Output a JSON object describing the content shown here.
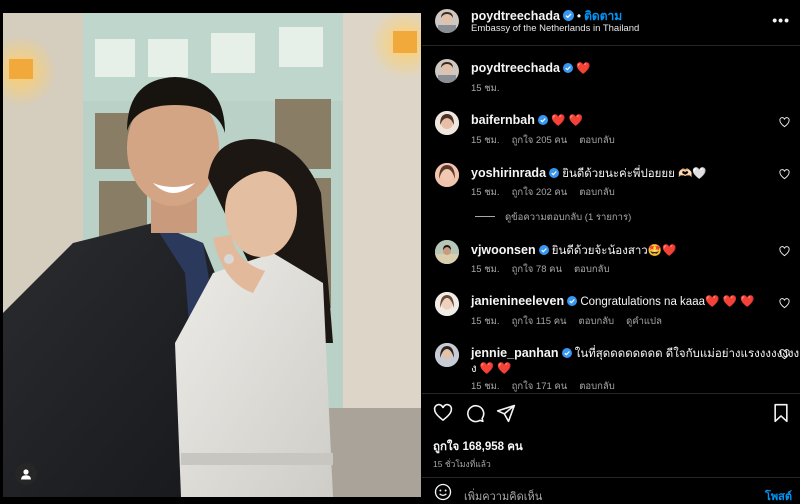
{
  "post": {
    "author": "poydtreechada",
    "follow_label": "ติดตาม",
    "location": "Embassy of the Netherlands in Thailand",
    "caption_emoji": "❤️",
    "caption_time": "15 ชม.",
    "likes": "ถูกใจ 168,958 คน",
    "posted": "15 ชั่วโมงที่แล้ว",
    "add_comment_placeholder": "เพิ่มความคิดเห็น",
    "post_label": "โพสต์"
  },
  "comments": [
    {
      "user": "baifernbah",
      "text": "❤️ ❤️",
      "time": "15 ชม.",
      "likes": "ถูกใจ 205 คน",
      "reply": "ตอบกลับ"
    },
    {
      "user": "yoshirinrada",
      "text": "ยินดีด้วยนะค่ะพี่ปอยยย 🫶🏻🤍",
      "time": "15 ชม.",
      "likes": "ถูกใจ 202 คน",
      "reply": "ตอบกลับ"
    },
    {
      "user": "vjwoonsen",
      "text": "ยินดีด้วยจ้ะน้องสาว🤩❤️",
      "time": "15 ชม.",
      "likes": "ถูกใจ 78 คน",
      "reply": "ตอบกลับ"
    },
    {
      "user": "janienineeleven",
      "text": "Congratulations na kaaa❤️ ❤️ ❤️",
      "time": "15 ชม.",
      "likes": "ถูกใจ 115 คน",
      "reply": "ตอบกลับ",
      "translate": "ดูคำแปล"
    },
    {
      "user": "jennie_panhan",
      "text": "ในที่สุดดดดดดดด ดีใจกับแม่อย่างแรงงงงงงงง",
      "text2": "ง ❤️ ❤️",
      "time": "15 ชม.",
      "likes": "ถูกใจ 171 คน",
      "reply": "ตอบกลับ"
    }
  ],
  "view_replies": "ดูข้อความตอบกลับ (1 รายการ)",
  "colors": {
    "accent": "#0095f6",
    "like_red": "#ed4956",
    "verified": "#3897f0"
  }
}
